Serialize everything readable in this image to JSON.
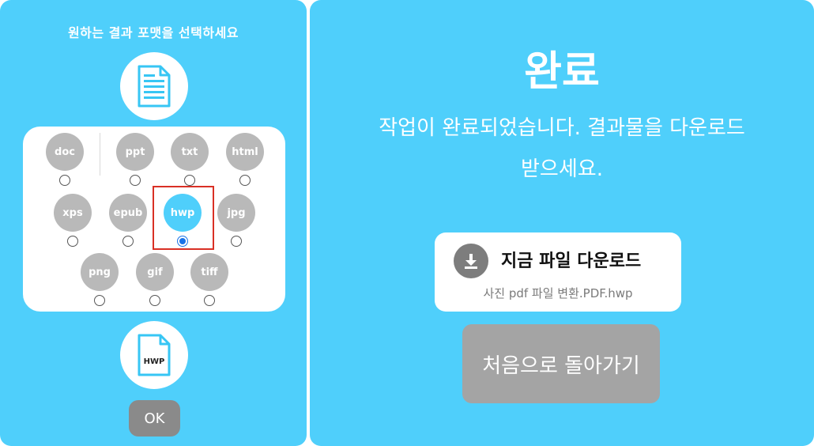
{
  "left": {
    "title": "원하는 결과 포맷을 선택하세요",
    "icons": {
      "top": "document-icon",
      "bottom": "hwp-file-icon"
    },
    "bottom_icon_label": "HWP",
    "formats": [
      {
        "label": "doc",
        "selected": false
      },
      {
        "label": "ppt",
        "selected": false
      },
      {
        "label": "txt",
        "selected": false
      },
      {
        "label": "html",
        "selected": false
      },
      {
        "label": "xps",
        "selected": false
      },
      {
        "label": "epub",
        "selected": false
      },
      {
        "label": "hwp",
        "selected": true
      },
      {
        "label": "jpg",
        "selected": false
      },
      {
        "label": "png",
        "selected": false
      },
      {
        "label": "gif",
        "selected": false
      },
      {
        "label": "tiff",
        "selected": false
      }
    ],
    "ok_label": "OK"
  },
  "right": {
    "title": "완료",
    "message_line1": "작업이 완료되었습니다. 결과물을 다운로드",
    "message_line2": "받으세요.",
    "download": {
      "icon": "download-icon",
      "label": "지금 파일 다운로드",
      "filename": "사진 pdf 파일 변환.PDF.hwp"
    },
    "back_label": "처음으로 돌아가기"
  },
  "colors": {
    "background": "#4fcffb",
    "format_bubble": "#b9b9b9",
    "selected_bubble": "#4fcffb",
    "radio_selected": "#1a73e8",
    "highlight_frame": "#d93025",
    "ok_button": "#8a8a8a",
    "back_button": "#a4a4a4"
  }
}
